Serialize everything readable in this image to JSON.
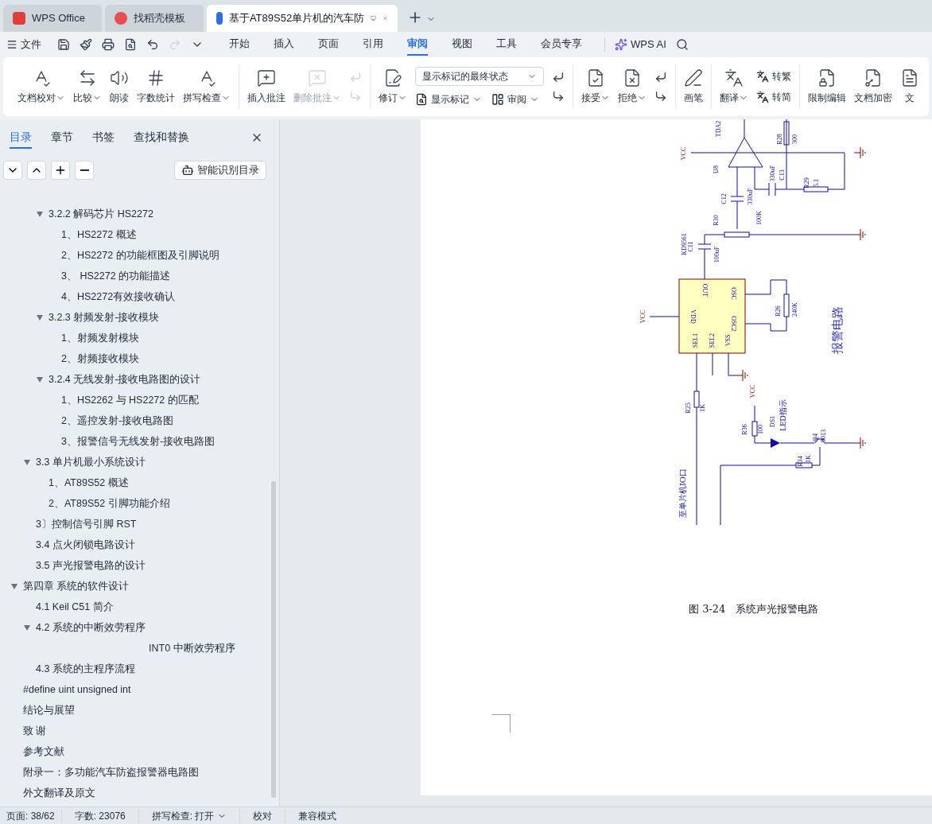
{
  "tabs": [
    {
      "label": "WPS Office",
      "kind": "home",
      "selected": false
    },
    {
      "label": "找稻壳模板",
      "kind": "template",
      "selected": false
    },
    {
      "label": "基于AT89S52单片机的汽车防",
      "kind": "doc",
      "selected": true
    }
  ],
  "menu": {
    "file": "文件",
    "tabs": [
      {
        "label": "开始",
        "selected": false
      },
      {
        "label": "插入",
        "selected": false
      },
      {
        "label": "页面",
        "selected": false
      },
      {
        "label": "引用",
        "selected": false
      },
      {
        "label": "审阅",
        "selected": true
      },
      {
        "label": "视图",
        "selected": false
      },
      {
        "label": "工具",
        "selected": false
      },
      {
        "label": "会员专享",
        "selected": false
      }
    ],
    "ai": "WPS AI"
  },
  "ribbon": [
    {
      "items": [
        {
          "kind": "large",
          "label": "文档校对",
          "has_menu": true,
          "disabled": false
        },
        {
          "kind": "large",
          "label": "比较",
          "has_menu": true,
          "disabled": false
        },
        {
          "kind": "large",
          "label": "朗读",
          "has_menu": false,
          "disabled": false
        },
        {
          "kind": "large",
          "label": "字数统计",
          "has_menu": false,
          "disabled": false
        },
        {
          "kind": "large",
          "label": "拼写检查",
          "has_menu": true,
          "disabled": false
        }
      ]
    },
    {
      "items": [
        {
          "kind": "large",
          "label": "插入批注",
          "has_menu": false,
          "disabled": false
        },
        {
          "kind": "large",
          "label": "删除批注",
          "has_menu": true,
          "disabled": true
        },
        {
          "kind": "icons",
          "disabled": true
        }
      ]
    },
    {
      "items": [
        {
          "kind": "large",
          "label": "修订",
          "has_menu": true,
          "disabled": false
        },
        {
          "kind": "review",
          "value": "显示标记的最终状态",
          "show": "显示标记",
          "pane": "审阅"
        },
        {
          "kind": "icons",
          "disabled": false
        }
      ]
    },
    {
      "items": [
        {
          "kind": "large",
          "label": "接受",
          "has_menu": true,
          "disabled": false
        },
        {
          "kind": "large",
          "label": "拒绝",
          "has_menu": true,
          "disabled": false
        },
        {
          "kind": "icons",
          "disabled": false
        }
      ]
    },
    {
      "items": [
        {
          "kind": "large",
          "label": "画笔",
          "has_menu": false,
          "disabled": false
        }
      ]
    },
    {
      "items": [
        {
          "kind": "large",
          "label": "翻译",
          "has_menu": true,
          "disabled": false
        },
        {
          "kind": "convert",
          "top": "转繁",
          "bottom": "转简"
        }
      ]
    },
    {
      "items": [
        {
          "kind": "large",
          "label": "限制编辑",
          "has_menu": false,
          "disabled": false
        },
        {
          "kind": "large",
          "label": "文档加密",
          "has_menu": false,
          "disabled": false
        },
        {
          "kind": "large",
          "label": "文",
          "has_menu": false,
          "disabled": false
        }
      ]
    }
  ],
  "sidebar": {
    "tabs": [
      {
        "label": "目录",
        "selected": true
      },
      {
        "label": "章节",
        "selected": false
      },
      {
        "label": "书签",
        "selected": false
      },
      {
        "label": "查找和替换",
        "selected": false
      }
    ],
    "smart_button": "智能识别目录",
    "toc_level3": [
      {
        "label": "3.2.2  解码芯片 HS2272",
        "expanded": true,
        "children": [
          {
            "label": "1、HS2272 概述"
          },
          {
            "label": "2、HS2272 的功能框图及引脚说明"
          },
          {
            "label": "3、  HS2272 的功能描述"
          },
          {
            "label": "4、HS2272有效接收确认"
          }
        ]
      },
      {
        "label": "3.2.3  射频发射-接收模块",
        "expanded": true,
        "children": [
          {
            "label": "1、射频发射模块"
          },
          {
            "label": "2、射频接收模块"
          }
        ]
      },
      {
        "label": "3.2.4  无线发射-接收电路图的设计",
        "expanded": true,
        "children": [
          {
            "label": "1、HS2262 与 HS2272 的匹配"
          },
          {
            "label": "2、遥控发射-接收电路图"
          },
          {
            "label": "3、报警信号无线发射-接收电路图"
          }
        ]
      }
    ],
    "toc_level2": [
      {
        "label": "3.3  单片机最小系统设计",
        "expanded": true,
        "children": [
          {
            "label": "1、AT89S52 概述"
          },
          {
            "label": "2、AT89S52 引脚功能介绍"
          }
        ]
      },
      {
        "label": "3〕控制信号引脚 RST"
      },
      {
        "label": "3.4  点火闭锁电路设计"
      },
      {
        "label": "3.5  声光报警电路的设计"
      }
    ],
    "toc": [
      {
        "label": "第四章  系统的软件设计",
        "expanded": true,
        "children": [
          {
            "label": "4.1 Keil C51 简介"
          },
          {
            "label": "4.2  系统的中断效劳程序",
            "expanded": true,
            "children": [
              {
                "label": "INT0 中断效劳程序",
                "kind": "far"
              }
            ]
          },
          {
            "label": "4.3  系统的主程序流程"
          }
        ]
      },
      {
        "label": "#define uint unsigned int"
      },
      {
        "label": "结论与展望"
      },
      {
        "label": "致    谢"
      },
      {
        "label": "参考文献"
      },
      {
        "label": "附录一：多功能汽车防盗报警器电路图"
      },
      {
        "label": "外文翻译及原文"
      }
    ]
  },
  "circuit": {
    "labels": [
      "TDA2",
      "VCC",
      "U8",
      "R28",
      "300",
      "330uF",
      "C13",
      "R29",
      "5.1",
      "C12",
      "330uF",
      "R30",
      "100K",
      "KD9561",
      "C11",
      "100uF",
      "OUT",
      "OSC",
      "VDD",
      "OSC2",
      "SEL1",
      "SEL2",
      "VSS",
      "R26",
      "240K",
      "VCC",
      "R25",
      "1K",
      "VCC",
      "R36",
      "100",
      "DS1",
      "LED指示",
      "Q4",
      "9013",
      "R34",
      "1K"
    ],
    "title": "报警电路",
    "io_label": "至单片机IO口"
  },
  "caption": "图 3-24   系统声光报警电路",
  "status_bar": {
    "page": "页面: 38/62",
    "words": "字数: 23076",
    "spell": "拼写检查: 打开",
    "proof": "校对",
    "mode": "兼容模式"
  }
}
